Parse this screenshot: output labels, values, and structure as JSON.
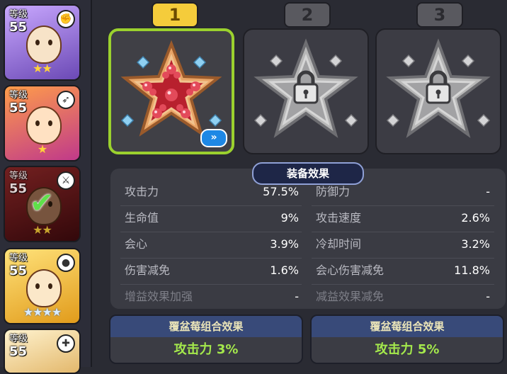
{
  "cookies": [
    {
      "level_label": "等级",
      "level": "55",
      "class_icon": "fist-icon",
      "stars": "★★",
      "bg": "#8f6cc7"
    },
    {
      "level_label": "等级",
      "level": "55",
      "class_icon": "crossbow-icon",
      "stars": "★",
      "bg": "#e26a2a"
    },
    {
      "level_label": "等级",
      "level": "55",
      "class_icon": "sword-icon",
      "stars": "★★",
      "bg": "#b72a2a",
      "selected": true
    },
    {
      "level_label": "等级",
      "level": "55",
      "class_icon": "bomb-icon",
      "stars": "★★★★",
      "bg": "#f1b93a"
    },
    {
      "level_label": "等级",
      "level": "55",
      "class_icon": "healing-icon",
      "stars": "",
      "bg": "#f0d9a6"
    }
  ],
  "topping_slots": [
    {
      "number": "1",
      "state": "equipped",
      "topping": "raspberry-topping-icon",
      "upgrade_label": "»"
    },
    {
      "number": "2",
      "state": "locked",
      "topping": "lock-icon"
    },
    {
      "number": "3",
      "state": "locked",
      "topping": "lock-icon"
    }
  ],
  "effects": {
    "title": "装备效果",
    "left": [
      {
        "name": "攻击力",
        "value": "57.5%"
      },
      {
        "name": "生命值",
        "value": "9%"
      },
      {
        "name": "会心",
        "value": "3.9%"
      },
      {
        "name": "伤害减免",
        "value": "1.6%"
      },
      {
        "name": "增益效果加强",
        "value": "-"
      }
    ],
    "right": [
      {
        "name": "防御力",
        "value": "-"
      },
      {
        "name": "攻击速度",
        "value": "2.6%"
      },
      {
        "name": "冷却时间",
        "value": "3.2%"
      },
      {
        "name": "会心伤害减免",
        "value": "11.8%"
      },
      {
        "name": "减益效果减免",
        "value": "-"
      }
    ]
  },
  "set_bonuses": [
    {
      "title": "覆盆莓组合效果",
      "effect": "攻击力 3%"
    },
    {
      "title": "覆盆莓组合效果",
      "effect": "攻击力 5%"
    }
  ],
  "colors": {
    "active_slot_border": "#9bd12e",
    "active_tab": "#f5cc3b",
    "set_effect_text": "#a4e84c",
    "set_header": "#384a79"
  }
}
